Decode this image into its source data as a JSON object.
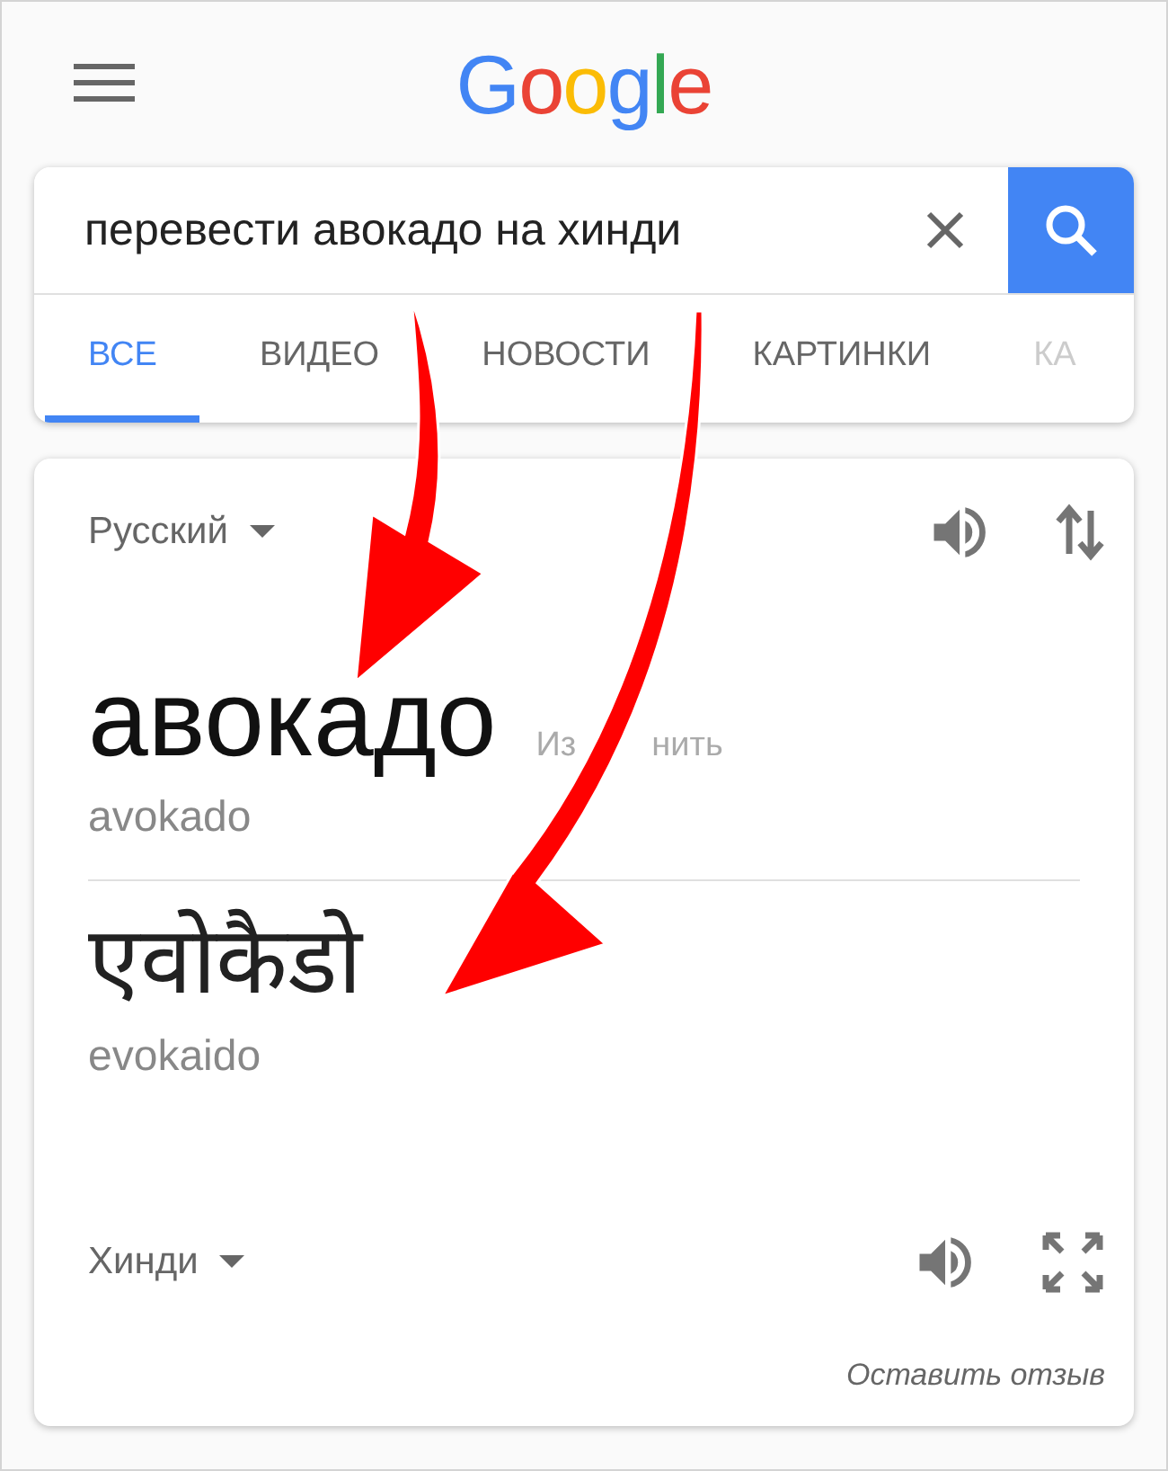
{
  "logo": "Google",
  "search": {
    "value": "перевести авокадо на хинди"
  },
  "tabs": [
    {
      "label": "ВСЕ",
      "selected": true
    },
    {
      "label": "ВИДЕО",
      "selected": false
    },
    {
      "label": "НОВОСТИ",
      "selected": false
    },
    {
      "label": "КАРТИНКИ",
      "selected": false
    },
    {
      "label": "КА",
      "selected": false
    }
  ],
  "translator": {
    "source": {
      "language": "Русский",
      "word": "авокадо",
      "edit": [
        "Из",
        "нить"
      ],
      "transliteration": "avokado"
    },
    "target": {
      "language": "Хинди",
      "word": "एवोकैडो",
      "transliteration": "evokaido"
    },
    "feedback": "Оставить отзыв"
  }
}
